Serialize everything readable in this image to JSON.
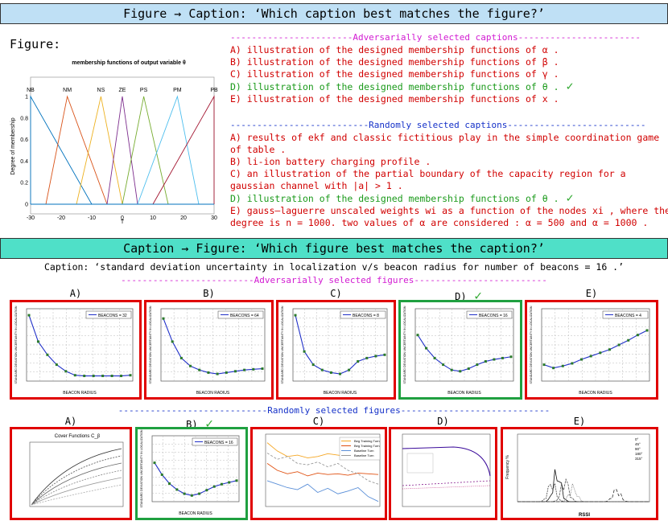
{
  "top_banner": "Figure → Caption: ‘Which caption best matches the figure?’",
  "figure_label": "Figure:",
  "main_figure": {
    "title": "membership functions of output variable θ",
    "ylabel": "Degree of membership",
    "xlabel": "T",
    "set_labels": [
      "NB",
      "NM",
      "NS",
      "ZE",
      "PS",
      "PM",
      "PB"
    ],
    "x_ticks": [
      "-30",
      "-20",
      "-10",
      "0",
      "10",
      "20",
      "30"
    ],
    "y_ticks": [
      "0",
      "0.2",
      "0.4",
      "0.6",
      "0.8",
      "1"
    ],
    "colors": [
      "#0072bd",
      "#d95319",
      "#edb120",
      "#7e2f8e",
      "#77ac30",
      "#4dbeee",
      "#a2142f"
    ]
  },
  "adversarial_captions": {
    "header": "-----------------------Adversarially selected captions-----------------------",
    "items": [
      "A) illustration of the designed membership functions of α .",
      "B) illustration of the designed membership functions of β .",
      "C) illustration of the designed membership functions of γ .",
      "D) illustration of the designed membership functions of θ .",
      "E) illustration of the designed membership functions of x ."
    ],
    "correct_index": 3
  },
  "random_captions": {
    "header": "--------------------------Randomly selected captions--------------------------",
    "lines": [
      {
        "text": "A) results of ekf and classic fictitious play in the simple coordination game",
        "correct": false
      },
      {
        "text": "of table .",
        "correct": false
      },
      {
        "text": "B) li-ion battery charging profile .",
        "correct": false
      },
      {
        "text": "C) an illustration of the partial boundary of the capacity region for a",
        "correct": false
      },
      {
        "text": "gaussian channel with |a| > 1 .",
        "correct": false
      },
      {
        "text": "D) illustration of the designed membership functions of θ .",
        "correct": true
      },
      {
        "text": "E) gauss–laguerre unscaled weights wi as a function of the nodes xi , where the",
        "correct": false
      },
      {
        "text": "degree is n = 1000. two values of α are considered : α = 500 and α = 1000 .",
        "correct": false
      }
    ]
  },
  "check_mark": "✓",
  "mid_banner": "Caption → Figure: ‘Which figure best matches the caption?’",
  "caption_line": "Caption: ‘standard deviation uncertainty in localization v/s beacon radius for number of beacons = 16 .’",
  "adv_fig_header": "-------------------------Adversarially selected figures-------------------------",
  "rand_fig_header": "----------------------------Randomly selected figures----------------------------",
  "adv_figs": [
    {
      "label": "A)",
      "legend": "BEACONS = 32",
      "correct": false
    },
    {
      "label": "B)",
      "legend": "BEACONS = 64",
      "correct": false
    },
    {
      "label": "C)",
      "legend": "BEACONS = 8",
      "correct": false
    },
    {
      "label": "D)",
      "legend": "BEACONS = 16",
      "correct": true
    },
    {
      "label": "E)",
      "legend": "BEACONS = 4",
      "correct": false
    }
  ],
  "rand_figs": [
    {
      "label": "A)",
      "title": "Cover Functions C_β",
      "correct": false
    },
    {
      "label": "B)",
      "legend": "BEACONS = 16",
      "correct": true
    },
    {
      "label": "C)",
      "legend": [
        "Beg Training Turn",
        "Beg Training Turn",
        "Baseline Turn",
        "Baseline Turn"
      ],
      "correct": false
    },
    {
      "label": "D)",
      "correct": false
    },
    {
      "label": "E)",
      "xlabel": "RSSI",
      "ylabel": "Frequency %",
      "legend": [
        "0°",
        "45°",
        "90°",
        "180°",
        "315°"
      ],
      "correct": false
    }
  ],
  "beacon_axes": {
    "xlabel": "BEACON RADIUS",
    "ylabel": "STANDARD DEVIATION UNCERTAINTY IN LOCALIZATION"
  }
}
